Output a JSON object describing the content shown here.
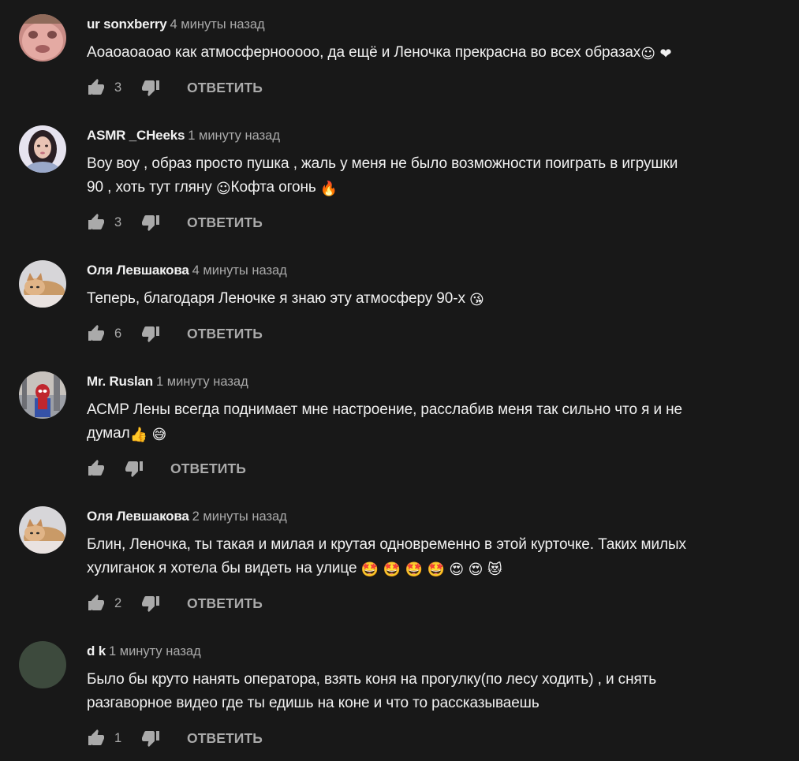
{
  "reply_label": "ОТВЕТИТЬ",
  "colors": {
    "background": "#181818",
    "text_primary": "#f1f1f1",
    "text_secondary": "#aaaaaa"
  },
  "comments": [
    {
      "author": "ur sonxberry",
      "time": "4 минуты назад",
      "text": "Аоаоаоаоао как атмосферноoooo, да ещё и Леночка прекрасна во всех образах",
      "emojis": "☺ ❤",
      "likes": "3",
      "avatar_icon": "face-closeup-avatar"
    },
    {
      "author": "ASMR _CHeeks",
      "time": "1 минуту назад",
      "text_line1": "Воу воу , образ просто пушка , жаль у меня не было возможности поиграть в игрушки",
      "text_line2": "90 , хоть тут  гляну ",
      "emoji1": "☺",
      "text_line2b": "Кофта огонь ",
      "emoji2": "🔥",
      "likes": "3",
      "avatar_icon": "girl-portrait-avatar"
    },
    {
      "author": "Оля Левшакова",
      "time": "4 минуты назад",
      "text": "Теперь, благодаря Леночке я знаю эту атмосферу 90-х ",
      "emojis": "😘",
      "likes": "6",
      "avatar_icon": "kitten-avatar"
    },
    {
      "author": "Mr. Ruslan",
      "time": "1 минуту назад",
      "text_line1": "АСМР Лены всегда поднимает мне настроение, расслабив меня так сильно что я и не",
      "text_line2": "думал",
      "emojis": "👍 😅",
      "likes": "",
      "avatar_icon": "spider-man-avatar"
    },
    {
      "author": "Оля Левшакова",
      "time": "2 минуты назад",
      "text_line1": "Блин, Леночка, ты такая и милая и крутая одновременно в этой курточке. Таких милых",
      "text_line2": "хулиганок я хотела бы видеть на улице ",
      "emojis": "🤩 🤩 🤩 🤩 😍 😍 😻",
      "likes": "2",
      "avatar_icon": "kitten-avatar"
    },
    {
      "author": "d k",
      "time": "1 минуту назад",
      "text_line1": "Было бы круто нанять оператора, взять коня на прогулку(по лесу ходить) , и снять",
      "text_line2": "разгаворное видео где ты едишь на коне и что то рассказываешь",
      "likes": "1",
      "avatar_icon": "default-avatar",
      "avatar_color": "#3d4a3d"
    }
  ]
}
